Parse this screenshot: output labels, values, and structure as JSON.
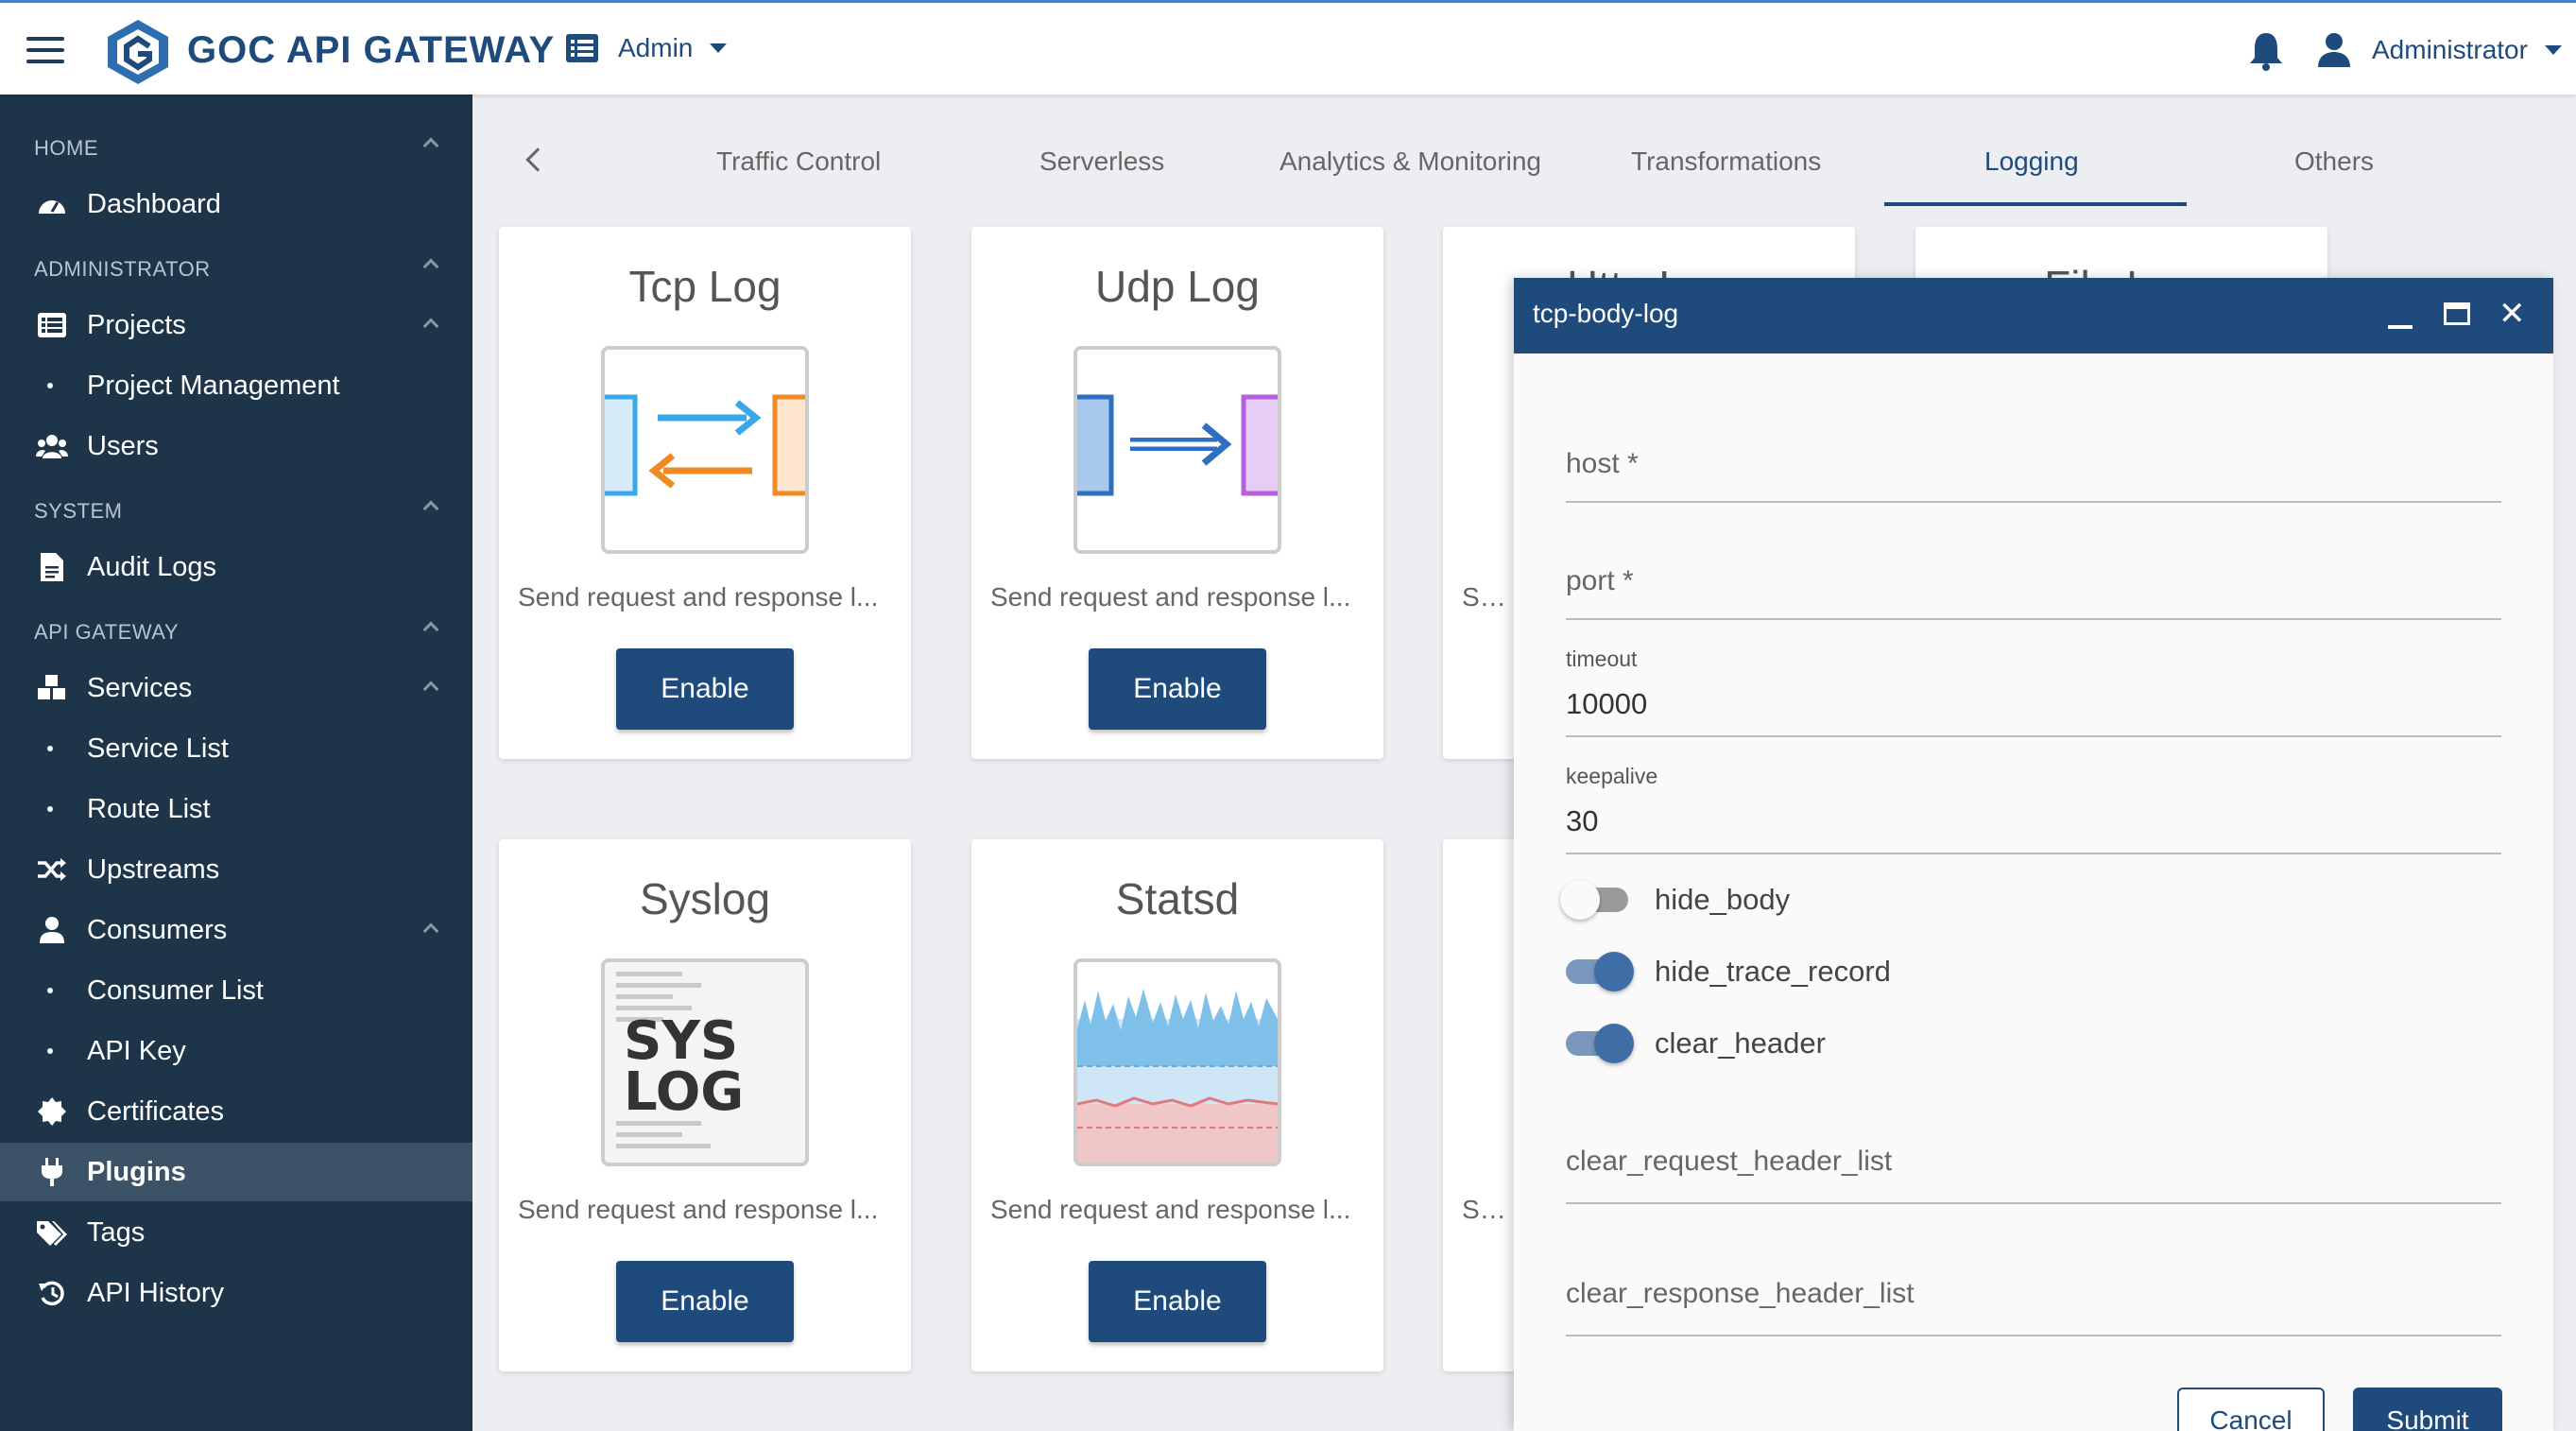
{
  "header": {
    "brand": "GOC API GATEWAY",
    "workspace": "Admin",
    "user": "Administrator"
  },
  "sidebar": {
    "sections": {
      "home": "HOME",
      "administrator": "ADMINISTRATOR",
      "system": "SYSTEM",
      "api_gateway": "API GATEWAY"
    },
    "items": {
      "dashboard": "Dashboard",
      "projects": "Projects",
      "project_management": "Project Management",
      "users": "Users",
      "audit_logs": "Audit Logs",
      "services": "Services",
      "service_list": "Service List",
      "route_list": "Route List",
      "upstreams": "Upstreams",
      "consumers": "Consumers",
      "consumer_list": "Consumer List",
      "api_key": "API Key",
      "certificates": "Certificates",
      "plugins": "Plugins",
      "tags": "Tags",
      "api_history": "API History"
    }
  },
  "tabs": {
    "traffic_control": "Traffic Control",
    "serverless": "Serverless",
    "analytics": "Analytics & Monitoring",
    "transformations": "Transformations",
    "logging": "Logging",
    "others": "Others",
    "active": "Logging"
  },
  "cards": {
    "tcp_log": {
      "title": "Tcp Log",
      "desc": "Send request and response l...",
      "button": "Enable"
    },
    "udp_log": {
      "title": "Udp Log",
      "desc": "Send request and response l...",
      "button": "Enable"
    },
    "http_log": {
      "title": "Http Log",
      "desc": "Send request and response l..."
    },
    "file_log": {
      "title": "File Log"
    },
    "syslog": {
      "title": "Syslog",
      "desc": "Send request and response l...",
      "button": "Enable",
      "image_text_1": "SYS",
      "image_text_2": "LOG"
    },
    "statsd": {
      "title": "Statsd",
      "desc": "Send request and response l...",
      "button": "Enable"
    },
    "third_row_partial": {
      "desc": "Send request and response l..."
    }
  },
  "dialog": {
    "title": "tcp-body-log",
    "fields": {
      "host_label": "host *",
      "port_label": "port *",
      "timeout_label": "timeout",
      "timeout_value": "10000",
      "keepalive_label": "keepalive",
      "keepalive_value": "30",
      "clear_request_header_list": "clear_request_header_list",
      "clear_response_header_list": "clear_response_header_list"
    },
    "toggles": {
      "hide_body": {
        "label": "hide_body",
        "on": false
      },
      "hide_trace_record": {
        "label": "hide_trace_record",
        "on": true
      },
      "clear_header": {
        "label": "clear_header",
        "on": true
      }
    },
    "cancel": "Cancel",
    "submit": "Submit"
  },
  "colors": {
    "primary": "#1e4a7c",
    "sidebar_bg": "#1d3449",
    "sidebar_active": "#3c5266",
    "toggle_on": "#3f6ea6"
  }
}
